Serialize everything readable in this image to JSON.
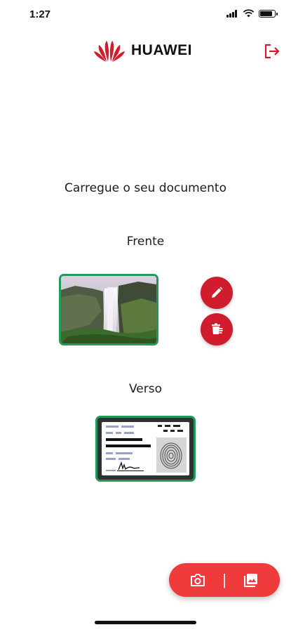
{
  "status_bar": {
    "time": "1:27"
  },
  "header": {
    "brand": "HUAWEI"
  },
  "main": {
    "title": "Carregue o seu documento",
    "front_label": "Frente",
    "back_label": "Verso"
  },
  "icons": {
    "logout": "logout-icon",
    "edit": "pencil-icon",
    "delete": "trash-icon",
    "camera": "camera-icon",
    "gallery": "gallery-icon"
  },
  "actions": {
    "separator": "|"
  },
  "colors": {
    "brand_red": "#cf1d2d",
    "pill_red": "#ef3b3b",
    "frame_green": "#1f9a5a"
  }
}
